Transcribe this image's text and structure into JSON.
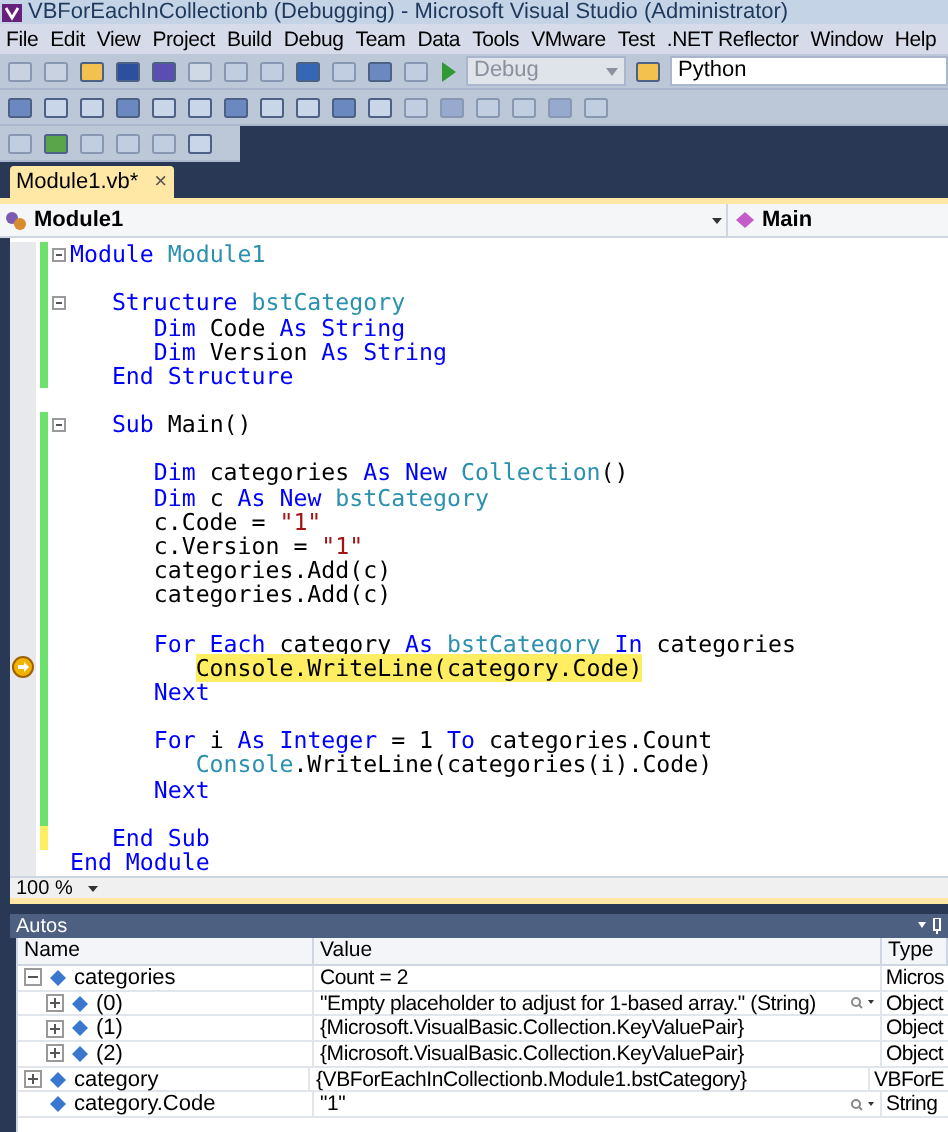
{
  "window": {
    "title": "VBForEachInCollectionb (Debugging) - Microsoft Visual Studio (Administrator)"
  },
  "menu": [
    "File",
    "Edit",
    "View",
    "Project",
    "Build",
    "Debug",
    "Team",
    "Data",
    "Tools",
    "VMware",
    "Test",
    ".NET Reflector",
    "Window",
    "Help"
  ],
  "toolbar": {
    "configuration": {
      "value": "Debug",
      "disabled": true
    },
    "find_box": {
      "value": "Python"
    }
  },
  "tabs": [
    {
      "label": "Module1.vb*",
      "selected": true,
      "close": "×"
    }
  ],
  "navigation": {
    "type_box": "Module1",
    "member_box": "Main"
  },
  "code": [
    {
      "modified": true,
      "saved": true,
      "collapsible": true,
      "current": false,
      "tokens": [
        {
          "text": "Module",
          "kind": "keyword"
        },
        {
          "text": " Module1",
          "kind": "type"
        }
      ]
    },
    {
      "modified": true,
      "saved": true,
      "collapsible": false,
      "current": false
    },
    {
      "modified": true,
      "saved": true,
      "collapsible": true,
      "current": false,
      "tokens": [
        {
          "text": "   Structure",
          "kind": "keyword"
        },
        {
          "text": " bstCategory",
          "kind": "type"
        }
      ]
    },
    {
      "modified": true,
      "saved": true,
      "collapsible": false,
      "current": false,
      "tokens": [
        {
          "text": "      Dim",
          "kind": "keyword"
        },
        {
          "text": " Code ",
          "kind": "plain"
        },
        {
          "text": "As String",
          "kind": "keyword"
        }
      ]
    },
    {
      "modified": true,
      "saved": true,
      "collapsible": false,
      "current": false,
      "tokens": [
        {
          "text": "      Dim",
          "kind": "keyword"
        },
        {
          "text": " Version ",
          "kind": "plain"
        },
        {
          "text": "As String",
          "kind": "keyword"
        }
      ]
    },
    {
      "modified": true,
      "saved": true,
      "collapsible": false,
      "current": false,
      "tokens": [
        {
          "text": "   End Structure",
          "kind": "keyword"
        }
      ]
    },
    {
      "modified": false,
      "collapsible": false,
      "current": false
    },
    {
      "modified": true,
      "saved": true,
      "collapsible": true,
      "current": false,
      "tokens": [
        {
          "text": "   Sub",
          "kind": "keyword"
        },
        {
          "text": " Main()",
          "kind": "plain"
        }
      ]
    },
    {
      "modified": true,
      "saved": true,
      "collapsible": false,
      "current": false
    },
    {
      "modified": true,
      "saved": true,
      "collapsible": false,
      "current": false,
      "tokens": [
        {
          "text": "      Dim",
          "kind": "keyword"
        },
        {
          "text": " categories ",
          "kind": "plain"
        },
        {
          "text": "As New",
          "kind": "keyword"
        },
        {
          "text": " Collection",
          "kind": "type"
        },
        {
          "text": "()",
          "kind": "plain"
        }
      ]
    },
    {
      "modified": true,
      "saved": true,
      "collapsible": false,
      "current": false,
      "tokens": [
        {
          "text": "      Dim",
          "kind": "keyword"
        },
        {
          "text": " c ",
          "kind": "plain"
        },
        {
          "text": "As New",
          "kind": "keyword"
        },
        {
          "text": " bstCategory",
          "kind": "type"
        }
      ]
    },
    {
      "modified": true,
      "saved": true,
      "collapsible": false,
      "current": false,
      "tokens": [
        {
          "text": "      c.Code = ",
          "kind": "plain"
        },
        {
          "text": "\"1\"",
          "kind": "string"
        }
      ]
    },
    {
      "modified": true,
      "saved": true,
      "collapsible": false,
      "current": false,
      "tokens": [
        {
          "text": "      c.Version = ",
          "kind": "plain"
        },
        {
          "text": "\"1\"",
          "kind": "string"
        }
      ]
    },
    {
      "modified": true,
      "saved": true,
      "collapsible": false,
      "current": false,
      "tokens": [
        {
          "text": "      categories.Add(c)",
          "kind": "plain"
        }
      ]
    },
    {
      "modified": true,
      "saved": true,
      "collapsible": false,
      "current": false,
      "tokens": [
        {
          "text": "      categories.Add(c)",
          "kind": "plain"
        }
      ]
    },
    {
      "modified": true,
      "saved": true,
      "collapsible": false,
      "current": false
    },
    {
      "modified": true,
      "saved": true,
      "collapsible": false,
      "current": false,
      "tokens": [
        {
          "text": "      For Each",
          "kind": "keyword"
        },
        {
          "text": " category ",
          "kind": "plain"
        },
        {
          "text": "As",
          "kind": "keyword"
        },
        {
          "text": " bstCategory ",
          "kind": "type"
        },
        {
          "text": "In",
          "kind": "keyword"
        },
        {
          "text": " categories",
          "kind": "plain"
        }
      ]
    },
    {
      "modified": true,
      "saved": true,
      "collapsible": false,
      "current": true,
      "tokens": [
        {
          "text": "         Console.WriteLine(category.Code)",
          "kind": "plain"
        }
      ]
    },
    {
      "modified": true,
      "saved": true,
      "collapsible": false,
      "current": false,
      "tokens": [
        {
          "text": "      Next",
          "kind": "keyword"
        }
      ]
    },
    {
      "modified": true,
      "saved": true,
      "collapsible": false,
      "current": false
    },
    {
      "modified": true,
      "saved": true,
      "collapsible": false,
      "current": false,
      "tokens": [
        {
          "text": "      For",
          "kind": "keyword"
        },
        {
          "text": " i ",
          "kind": "plain"
        },
        {
          "text": "As Integer",
          "kind": "keyword"
        },
        {
          "text": " = 1 ",
          "kind": "plain"
        },
        {
          "text": "To",
          "kind": "keyword"
        },
        {
          "text": " categories.Count",
          "kind": "plain"
        }
      ]
    },
    {
      "modified": true,
      "saved": true,
      "collapsible": false,
      "current": false,
      "tokens": [
        {
          "text": "         Console",
          "kind": "type"
        },
        {
          "text": ".WriteLine(categories(i).Code)",
          "kind": "plain"
        }
      ]
    },
    {
      "modified": true,
      "saved": true,
      "collapsible": false,
      "current": false,
      "tokens": [
        {
          "text": "      Next",
          "kind": "keyword"
        }
      ]
    },
    {
      "modified": true,
      "saved": true,
      "collapsible": false,
      "current": false
    },
    {
      "modified": true,
      "saved": false,
      "collapsible": false,
      "current": false,
      "tokens": [
        {
          "text": "   End Sub",
          "kind": "keyword"
        }
      ]
    },
    {
      "modified": false,
      "collapsible": false,
      "current": false,
      "tokens": [
        {
          "text": "End Module",
          "kind": "keyword"
        }
      ]
    }
  ],
  "zoom": "100 %",
  "autos": {
    "title": "Autos",
    "columns": [
      "Name",
      "Value",
      "Type"
    ],
    "rows": [
      {
        "name": "categories",
        "value": "Count = 2",
        "type": "Micros",
        "expandable": true,
        "expanded": true,
        "visualizer": false,
        "children": [
          {
            "name": "(0)",
            "value": "\"Empty placeholder to adjust for 1-based array.\" (String)",
            "type": "Object",
            "expandable": true,
            "expanded": false,
            "visualizer": true
          },
          {
            "name": "(1)",
            "value": "{Microsoft.VisualBasic.Collection.KeyValuePair}",
            "type": "Object",
            "expandable": true,
            "expanded": false,
            "visualizer": false
          },
          {
            "name": "(2)",
            "value": "{Microsoft.VisualBasic.Collection.KeyValuePair}",
            "type": "Object",
            "expandable": true,
            "expanded": false,
            "visualizer": false
          }
        ]
      },
      {
        "name": "category",
        "value": "{VBForEachInCollectionb.Module1.bstCategory}",
        "type": "VBForE",
        "expandable": true,
        "expanded": false,
        "visualizer": false
      },
      {
        "name": "category.Code",
        "value": "\"1\"",
        "type": "String",
        "expandable": false,
        "visualizer": true
      }
    ]
  }
}
